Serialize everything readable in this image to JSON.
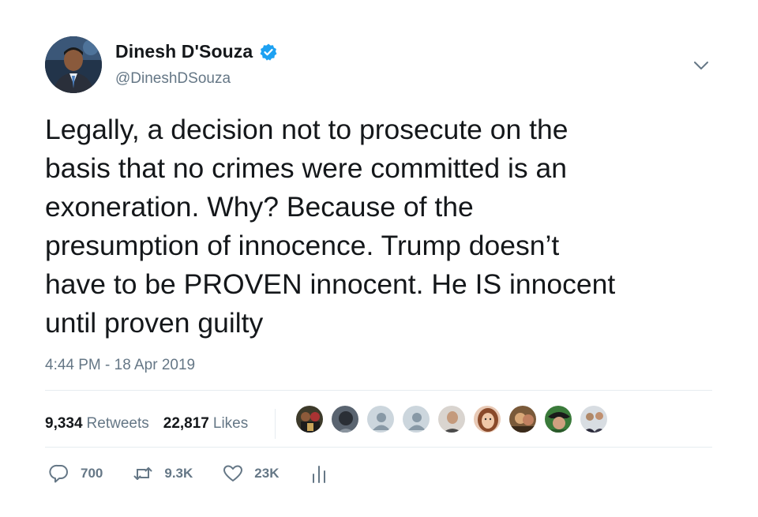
{
  "tweet": {
    "author": {
      "display_name": "Dinesh D'Souza",
      "handle": "@DineshDSouza",
      "verified": true
    },
    "text_lines": [
      "Legally, a decision not to prosecute on the",
      "basis that no crimes were committed is an",
      "exoneration. Why? Because of the",
      "presumption of innocence. Trump doesn’t",
      "have to be PROVEN innocent. He IS innocent",
      "until proven guilty"
    ],
    "timestamp": "4:44 PM - 18 Apr 2019",
    "stats": {
      "retweets_count": "9,334",
      "retweets_label": "Retweets",
      "likes_count": "22,817",
      "likes_label": "Likes"
    },
    "liker_avatars": [
      "avatar-1",
      "avatar-2",
      "default-avatar",
      "default-avatar",
      "avatar-5",
      "avatar-6",
      "avatar-7",
      "avatar-8",
      "avatar-9"
    ],
    "actions": {
      "replies": "700",
      "retweets": "9.3K",
      "likes": "23K"
    }
  },
  "colors": {
    "text": "#14171a",
    "secondary": "#657786",
    "verified_blue": "#1da1f2",
    "divider": "#e6ecf0"
  },
  "icons": [
    "verified-badge-icon",
    "chevron-down-icon",
    "reply-icon",
    "retweet-icon",
    "like-icon",
    "analytics-icon"
  ]
}
